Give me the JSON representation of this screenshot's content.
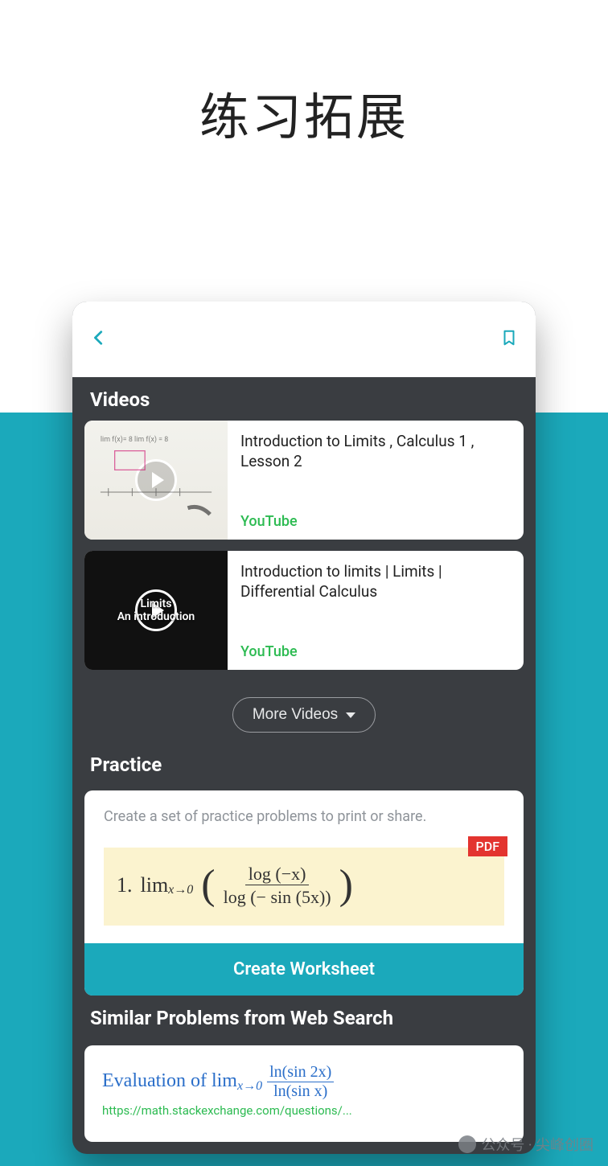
{
  "page": {
    "title": "练习拓展"
  },
  "sections": {
    "videos_label": "Videos",
    "practice_label": "Practice",
    "similar_label": "Similar Problems from Web Search"
  },
  "videos": [
    {
      "title": "Introduction to Limits , Calculus 1 , Lesson 2",
      "source": "YouTube",
      "thumb_overlay": ""
    },
    {
      "title": "Introduction to limits | Limits | Differential Calculus",
      "source": "YouTube",
      "thumb_overlay": "Limits\nAn introduction"
    }
  ],
  "more_videos_label": "More Videos",
  "practice": {
    "description": "Create a set of practice problems to print or share.",
    "pdf_badge": "PDF",
    "item_number": "1.",
    "lim_text": "lim",
    "lim_sub": "x→0",
    "frac_num": "log (−x)",
    "frac_den": "log (− sin (5x))",
    "create_button": "Create Worksheet"
  },
  "similar": {
    "prefix": "Evaluation of",
    "lim_text": "lim",
    "lim_sub": "x→0",
    "frac_num": "ln(sin 2x)",
    "frac_den": "ln(sin x)",
    "url_fragment": "https://math.stackexchange.com/questions/..."
  },
  "watermark": {
    "text": "公众号 · 尖峰创圈"
  },
  "colors": {
    "accent": "#1ba9bb",
    "source_green": "#2dbb52",
    "pdf_red": "#e3342f",
    "link_blue": "#2a6ec9"
  }
}
